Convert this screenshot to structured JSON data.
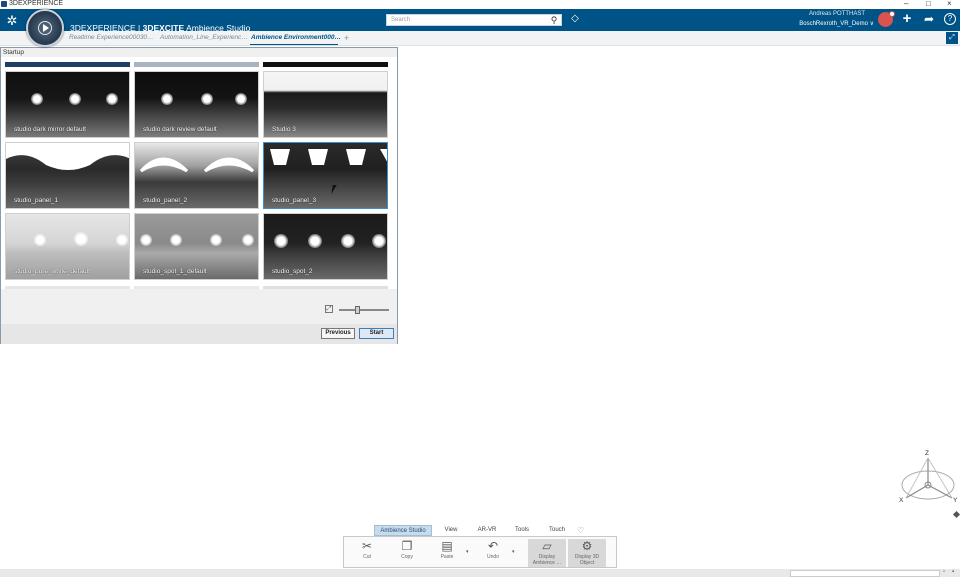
{
  "window": {
    "title": "3DEXPERIENCE",
    "controls": [
      "–",
      "□",
      "×"
    ]
  },
  "topbar": {
    "brand_prefix": "3DEXPERIENCE | ",
    "brand_bold": "3DEXCITE",
    "brand_suffix": " Ambience Studio",
    "search_placeholder": "Search",
    "user_name": "Andreas POTTHAST",
    "user_context": "BoschRexroth_VR_Demo ∨",
    "icons": [
      "3ds-logo-icon",
      "compass-icon",
      "search-icon",
      "tag-icon",
      "avatar",
      "plus-icon",
      "share-icon",
      "help-icon"
    ]
  },
  "tabs": [
    {
      "label": "Realtime Experience00030…",
      "active": false
    },
    {
      "label": "Automation_Line_Experienc…",
      "active": false
    },
    {
      "label": "Ambience Environment000…",
      "active": true
    }
  ],
  "dialog": {
    "title": "Startup",
    "thumbnails": [
      {
        "label": "studio dark mirror default",
        "selected": false
      },
      {
        "label": "studio dark review default",
        "selected": false
      },
      {
        "label": "Studio 3",
        "selected": false
      },
      {
        "label": "studio_panel_1",
        "selected": false
      },
      {
        "label": "studio_panel_2",
        "selected": false
      },
      {
        "label": "studio_panel_3",
        "selected": true
      },
      {
        "label": "studio_pure_white_default",
        "selected": false
      },
      {
        "label": "studio_spot_1_default",
        "selected": false
      },
      {
        "label": "studio_spot_2",
        "selected": false
      }
    ],
    "zoom_level": 0.35,
    "buttons": {
      "previous": "Previous",
      "start": "Start"
    }
  },
  "compass3d": {
    "axes": {
      "z": "Z",
      "x": "X",
      "y": "Y"
    }
  },
  "ribbon": {
    "tabs": [
      {
        "label": "Ambience Studio",
        "active": true
      },
      {
        "label": "View",
        "active": false
      },
      {
        "label": "AR-VR",
        "active": false
      },
      {
        "label": "Tools",
        "active": false
      },
      {
        "label": "Touch",
        "active": false
      }
    ],
    "commands": [
      {
        "label": "Cut",
        "icon": "scissors-icon"
      },
      {
        "label": "Copy",
        "icon": "copy-icon"
      },
      {
        "label": "Paste",
        "icon": "paste-icon"
      },
      {
        "label": "Undo",
        "icon": "undo-icon"
      },
      {
        "label": "Display Ambience …",
        "icon": "display-ambience-icon"
      },
      {
        "label": "Display 3D Object",
        "icon": "display-3d-object-icon"
      }
    ]
  },
  "colors": {
    "topbar": "#005386",
    "selection": "#3c8fce",
    "avatar": "#d9534f"
  }
}
